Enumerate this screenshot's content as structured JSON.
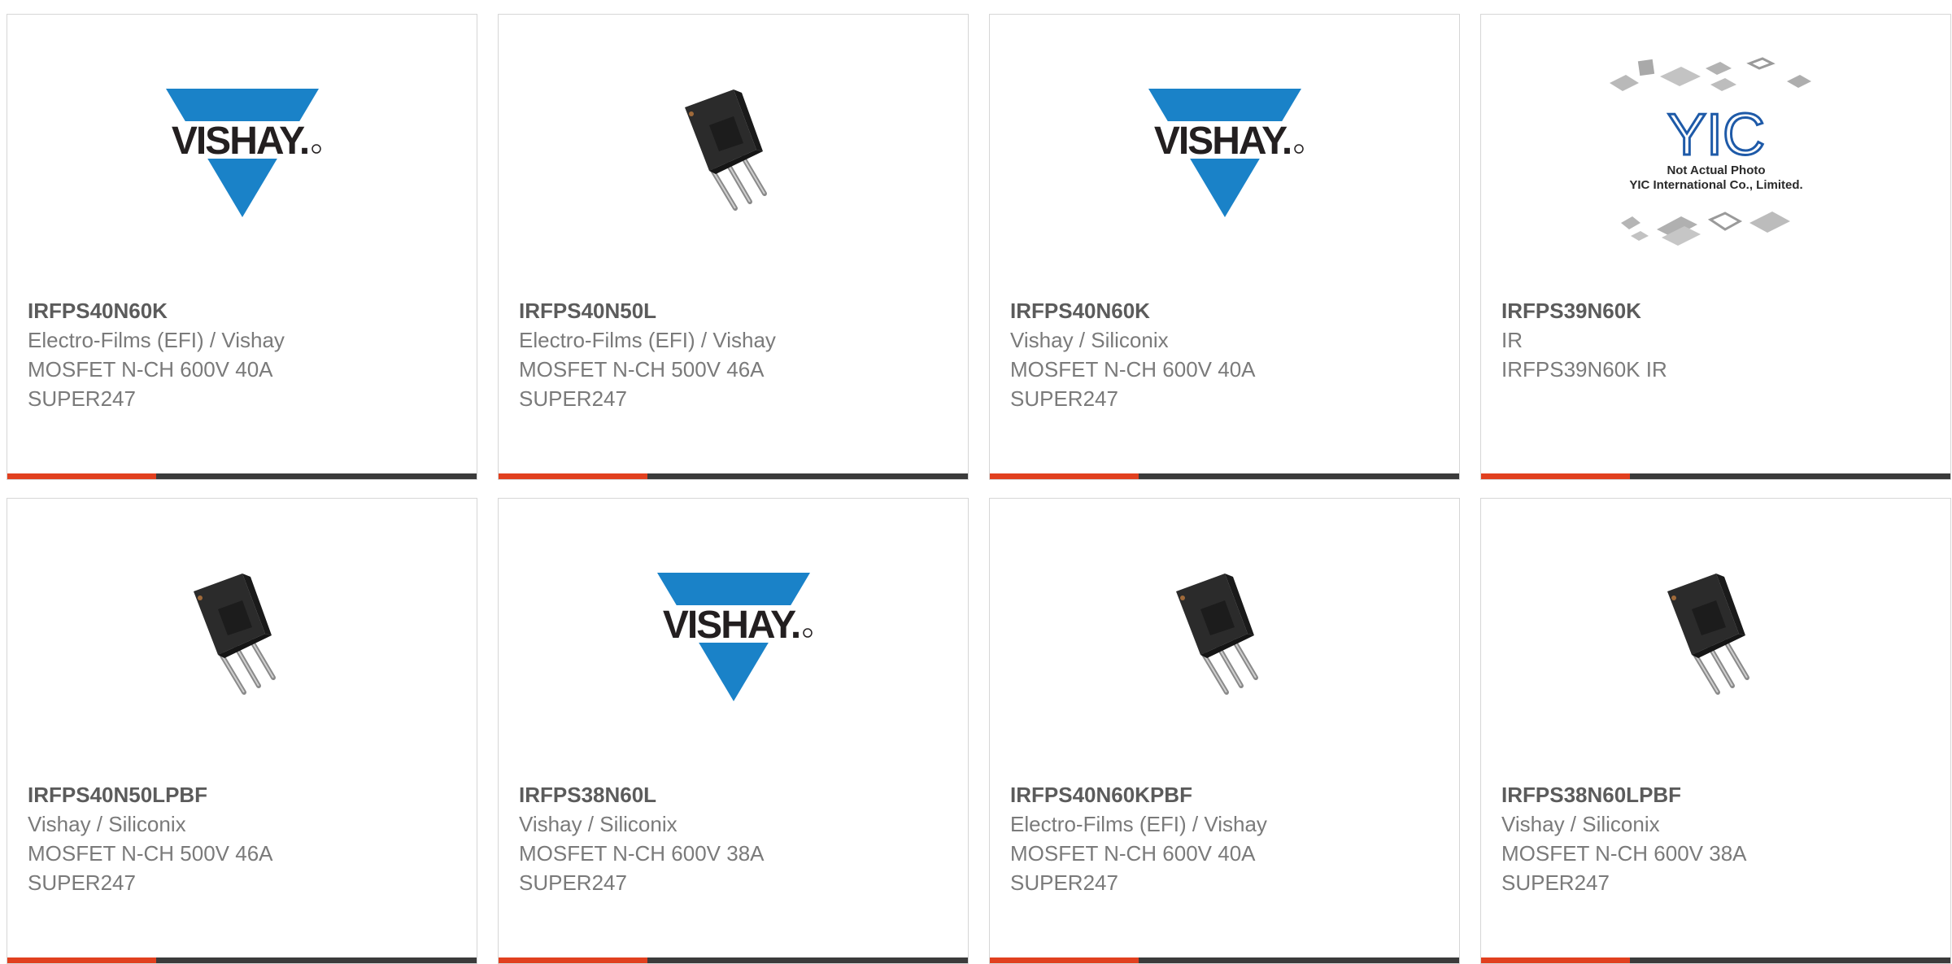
{
  "colors": {
    "accent": "#e1401f",
    "bar_dark": "#3b3b3b",
    "vishay_blue": "#1a82c8",
    "yic_blue": "#1e5aa8"
  },
  "products": [
    {
      "image": "vishay-logo",
      "logo_text": "VISHAY.",
      "part_number": "IRFPS40N60K",
      "manufacturer": "Electro-Films (EFI) / Vishay",
      "description": "MOSFET N-CH 600V 40A",
      "package": "SUPER247"
    },
    {
      "image": "transistor-photo",
      "part_number": "IRFPS40N50L",
      "manufacturer": "Electro-Films (EFI) / Vishay",
      "description": "MOSFET N-CH 500V 46A",
      "package": "SUPER247"
    },
    {
      "image": "vishay-logo",
      "logo_text": "VISHAY.",
      "part_number": "IRFPS40N60K",
      "manufacturer": "Vishay / Siliconix",
      "description": "MOSFET N-CH 600V 40A",
      "package": "SUPER247"
    },
    {
      "image": "yic-placeholder",
      "logo_text": "YIC",
      "photo_note_1": "Not Actual Photo",
      "photo_note_2": "YIC International Co., Limited.",
      "part_number": "IRFPS39N60K",
      "manufacturer": "IR",
      "description": "IRFPS39N60K IR",
      "package": ""
    },
    {
      "image": "transistor-photo",
      "part_number": "IRFPS40N50LPBF",
      "manufacturer": "Vishay / Siliconix",
      "description": "MOSFET N-CH 500V 46A",
      "package": "SUPER247"
    },
    {
      "image": "vishay-logo",
      "logo_text": "VISHAY.",
      "part_number": "IRFPS38N60L",
      "manufacturer": "Vishay / Siliconix",
      "description": "MOSFET N-CH 600V 38A",
      "package": "SUPER247"
    },
    {
      "image": "transistor-photo",
      "part_number": "IRFPS40N60KPBF",
      "manufacturer": "Electro-Films (EFI) / Vishay",
      "description": "MOSFET N-CH 600V 40A",
      "package": "SUPER247"
    },
    {
      "image": "transistor-photo",
      "part_number": "IRFPS38N60LPBF",
      "manufacturer": "Vishay / Siliconix",
      "description": "MOSFET N-CH 600V 38A",
      "package": "SUPER247"
    }
  ]
}
